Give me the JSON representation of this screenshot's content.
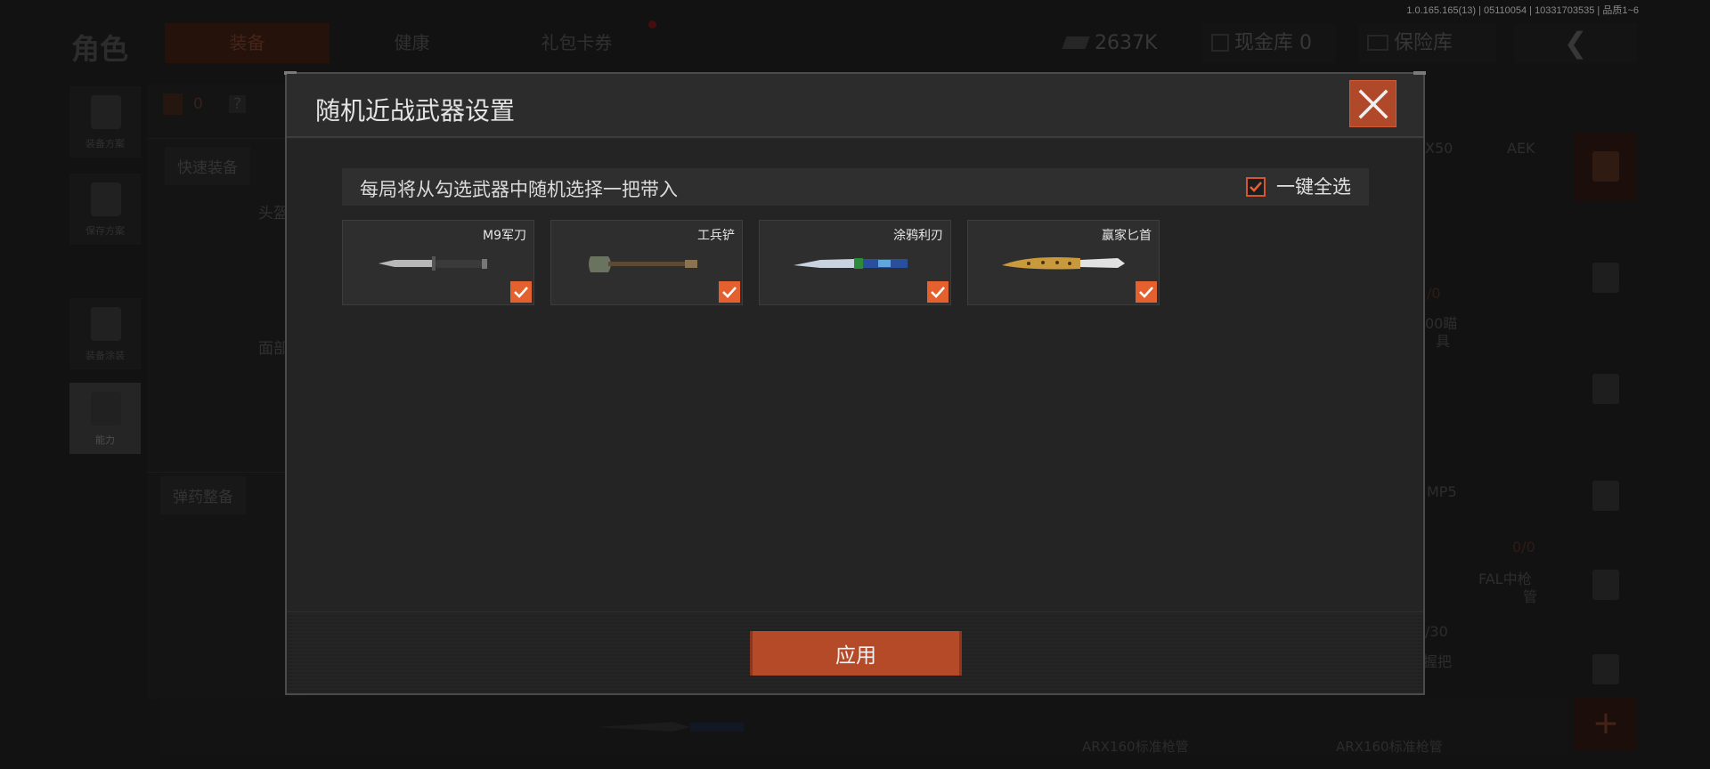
{
  "background": {
    "title": "角色",
    "tabs": [
      {
        "label": "装备",
        "active": true
      },
      {
        "label": "健康",
        "active": false
      },
      {
        "label": "礼包卡券",
        "active": false
      }
    ],
    "version": "1.0.165.165(13) | 05110054 | 10331703535 | 品质1~6",
    "money": "2637K",
    "cash_vault": "现金库 0",
    "safe_vault": "保险库",
    "left_rail": [
      "装备方案",
      "保存方案",
      "装备涂装",
      "能力"
    ],
    "armor_count": "0",
    "help": "?",
    "quick_equip": "快速装备",
    "helmet_slot": "头盔",
    "mask_slot": "面部",
    "ammo_equip": "弹药整备",
    "right_labels": [
      "X50",
      "AEK",
      "/0",
      "00瞄",
      "具",
      "MP5",
      "0/0",
      "FAL中枪",
      "管",
      "/30",
      "握把"
    ],
    "bottom_labels": [
      "ARX160标准枪管",
      "ARX160标准枪管"
    ]
  },
  "modal": {
    "title": "随机近战武器设置",
    "hint": "每局将从勾选武器中随机选择一把带入",
    "select_all_label": "一键全选",
    "select_all_checked": true,
    "weapons": [
      {
        "name": "M9军刀",
        "icon": "bayonet-knife",
        "checked": true
      },
      {
        "name": "工兵铲",
        "icon": "entrenching-shovel",
        "checked": true
      },
      {
        "name": "涂鸦利刃",
        "icon": "graffiti-blade",
        "checked": true
      },
      {
        "name": "赢家匕首",
        "icon": "golden-dagger",
        "checked": true
      }
    ],
    "apply_label": "应用"
  },
  "colors": {
    "accent": "#e4602e",
    "button": "#b54a28",
    "panel": "#262626"
  }
}
